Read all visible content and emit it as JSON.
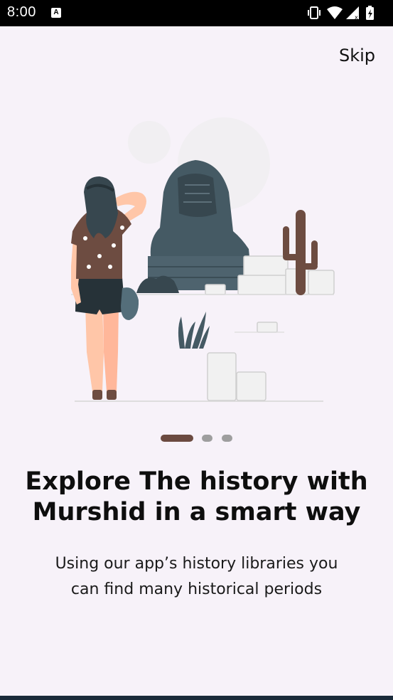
{
  "status_bar": {
    "time": "8:00",
    "badge": "A",
    "icons": [
      "vibrate-icon",
      "wifi-icon",
      "signal-icon",
      "battery-charging-icon"
    ]
  },
  "onboarding": {
    "skip_label": "Skip",
    "pager": {
      "total": 3,
      "current": 1
    },
    "title_line1": "Explore The history with",
    "title_line2": "Murshid in a smart way",
    "subtitle_line1": "Using our app’s history libraries you",
    "subtitle_line2": "can find many historical periods"
  },
  "colors": {
    "background": "#f7f2f9",
    "accent": "#6b4a40",
    "inactive_dot": "#9e9e9e",
    "sphinx": "#455a64",
    "cactus": "#6d4c41"
  }
}
